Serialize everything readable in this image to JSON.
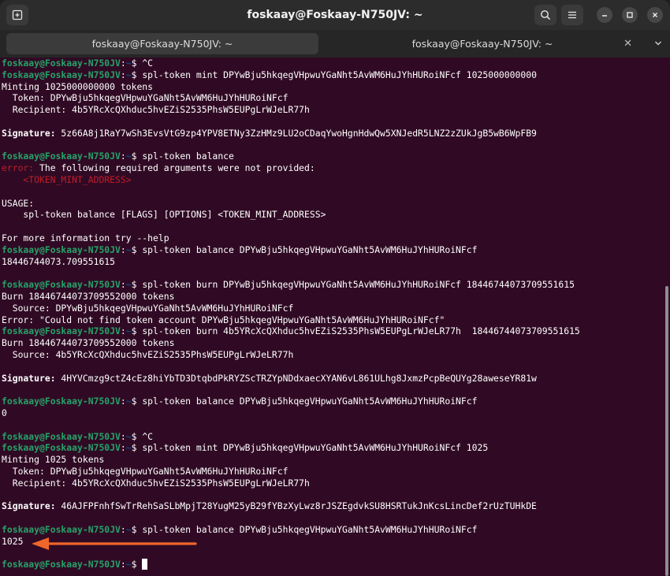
{
  "window": {
    "title": "foskaay@Foskaay-N750JV: ~"
  },
  "icons": {
    "new_tab": "new-tab-icon",
    "search": "search-icon",
    "menu": "hamburger-menu-icon",
    "minimize": "minimize-icon",
    "maximize": "maximize-icon",
    "close": "close-icon",
    "tab_close": "tab-close-icon",
    "tab_overflow": "chevron-down-icon"
  },
  "tabs": [
    {
      "label": "foskaay@Foskaay-N750JV: ~",
      "active": true
    },
    {
      "label": "foskaay@Foskaay-N750JV: ~",
      "active": false
    }
  ],
  "colors": {
    "terminal_bg": "#300a24",
    "prompt_user": "#26a269",
    "prompt_path": "#12488b",
    "error": "#c01c28",
    "annotation_arrow": "#f0662a"
  },
  "prompt": {
    "user": "foskaay@Foskaay-N750JV",
    "sep": ":",
    "path": "~",
    "dollar": "$ "
  },
  "lines": [
    {
      "type": "prompt",
      "cmd": "^C"
    },
    {
      "type": "prompt",
      "cmd": "spl-token mint DPYwBju5hkqegVHpwuYGaNht5AvWM6HuJYhHURoiNFcf 1025000000000"
    },
    {
      "type": "text",
      "text": "Minting 1025000000000 tokens"
    },
    {
      "type": "text",
      "text": "  Token: DPYwBju5hkqegVHpwuYGaNht5AvWM6HuJYhHURoiNFcf"
    },
    {
      "type": "text",
      "text": "  Recipient: 4b5YRcXcQXhduc5hvEZiS2535PhsW5EUPgLrWJeLR77h"
    },
    {
      "type": "blank"
    },
    {
      "type": "sig",
      "label": "Signature:",
      "text": " 5z66A8j1RaY7wSh3EvsVtG9zp4YPV8ETNy3ZzHMz9LU2oCDaqYwoHgnHdwQw5XNJedR5LNZ2zZUkJgB5wB6WpFB9"
    },
    {
      "type": "blank"
    },
    {
      "type": "prompt",
      "cmd": "spl-token balance"
    },
    {
      "type": "error",
      "label": "error:",
      "text": " The following required arguments were not provided:"
    },
    {
      "type": "red",
      "text": "    <TOKEN_MINT_ADDRESS>"
    },
    {
      "type": "blank"
    },
    {
      "type": "text",
      "text": "USAGE:"
    },
    {
      "type": "text",
      "text": "    spl-token balance [FLAGS] [OPTIONS] <TOKEN_MINT_ADDRESS>"
    },
    {
      "type": "blank"
    },
    {
      "type": "text",
      "text": "For more information try --help"
    },
    {
      "type": "prompt",
      "cmd": "spl-token balance DPYwBju5hkqegVHpwuYGaNht5AvWM6HuJYhHURoiNFcf"
    },
    {
      "type": "text",
      "text": "18446744073.709551615"
    },
    {
      "type": "blank"
    },
    {
      "type": "prompt",
      "cmd": "spl-token burn DPYwBju5hkqegVHpwuYGaNht5AvWM6HuJYhHURoiNFcf 18446744073709551615"
    },
    {
      "type": "text",
      "text": "Burn 18446744073709552000 tokens"
    },
    {
      "type": "text",
      "text": "  Source: DPYwBju5hkqegVHpwuYGaNht5AvWM6HuJYhHURoiNFcf"
    },
    {
      "type": "text",
      "text": "Error: \"Could not find token account DPYwBju5hkqegVHpwuYGaNht5AvWM6HuJYhHURoiNFcf\""
    },
    {
      "type": "prompt",
      "cmd": "spl-token burn 4b5YRcXcQXhduc5hvEZiS2535PhsW5EUPgLrWJeLR77h  18446744073709551615"
    },
    {
      "type": "text",
      "text": "Burn 18446744073709552000 tokens"
    },
    {
      "type": "text",
      "text": "  Source: 4b5YRcXcQXhduc5hvEZiS2535PhsW5EUPgLrWJeLR77h"
    },
    {
      "type": "blank"
    },
    {
      "type": "sig",
      "label": "Signature:",
      "text": " 4HYVCmzg9ctZ4cEz8hiYbTD3DtqbdPkRYZScTRZYpNDdxaecXYAN6vL861ULhg8JxmzPcpBeQUYg28aweseYR81w"
    },
    {
      "type": "blank"
    },
    {
      "type": "prompt",
      "cmd": "spl-token balance DPYwBju5hkqegVHpwuYGaNht5AvWM6HuJYhHURoiNFcf"
    },
    {
      "type": "text",
      "text": "0"
    },
    {
      "type": "blank"
    },
    {
      "type": "prompt",
      "cmd": "^C"
    },
    {
      "type": "prompt",
      "cmd": "spl-token mint DPYwBju5hkqegVHpwuYGaNht5AvWM6HuJYhHURoiNFcf 1025"
    },
    {
      "type": "text",
      "text": "Minting 1025 tokens"
    },
    {
      "type": "text",
      "text": "  Token: DPYwBju5hkqegVHpwuYGaNht5AvWM6HuJYhHURoiNFcf"
    },
    {
      "type": "text",
      "text": "  Recipient: 4b5YRcXcQXhduc5hvEZiS2535PhsW5EUPgLrWJeLR77h"
    },
    {
      "type": "blank"
    },
    {
      "type": "sig",
      "label": "Signature:",
      "text": " 46AJFPFnhfSwTrRehSaSLbMpjT28YugM25yB29fYBzXyLwz8rJSZEgdvkSU8HSRTukJnKcsLincDef2rUzTUHkDE"
    },
    {
      "type": "blank"
    },
    {
      "type": "prompt",
      "cmd": "spl-token balance DPYwBju5hkqegVHpwuYGaNht5AvWM6HuJYhHURoiNFcf"
    },
    {
      "type": "text",
      "text": "1025"
    },
    {
      "type": "blank"
    },
    {
      "type": "prompt",
      "cmd": "",
      "cursor": true
    }
  ]
}
